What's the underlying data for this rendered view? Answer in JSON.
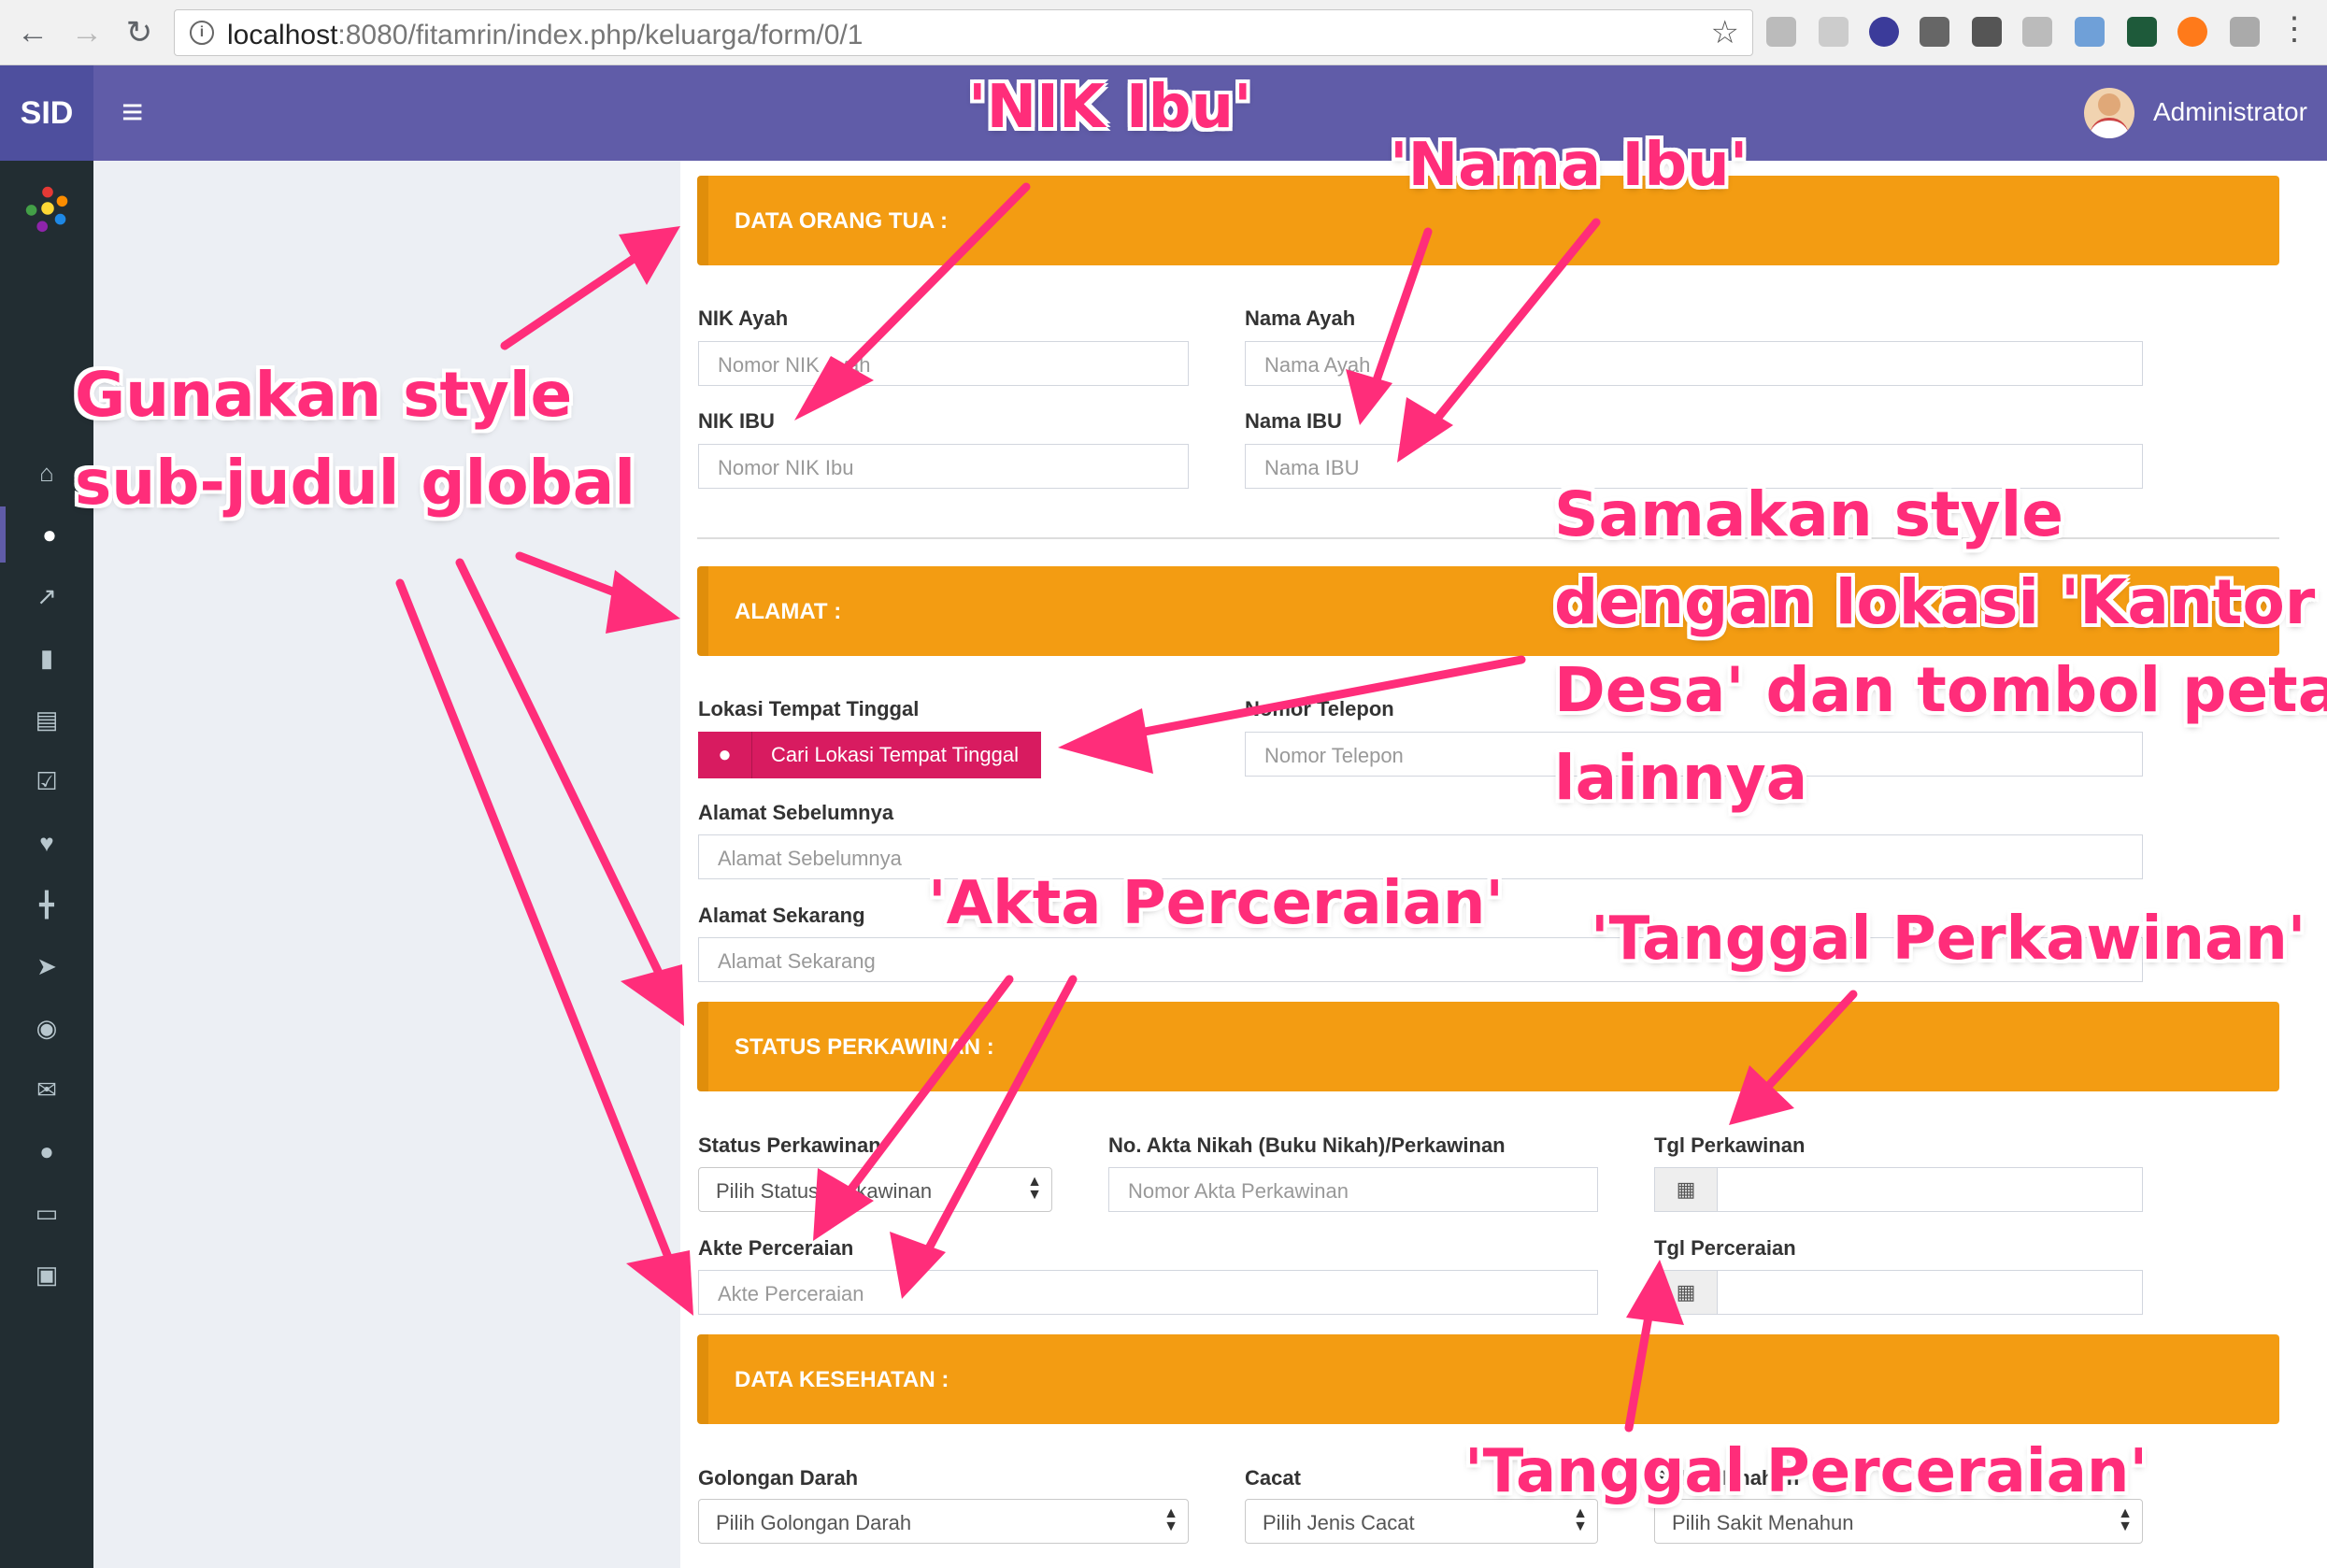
{
  "browser": {
    "url_host": "localhost",
    "url_rest": ":8080/fitamrin/index.php/keluarga/form/0/1",
    "info_icon": "i"
  },
  "header": {
    "brand": "SID",
    "user_name": "Administrator"
  },
  "sections": {
    "orang_tua": "DATA ORANG TUA :",
    "alamat": "ALAMAT :",
    "perkawinan": "STATUS PERKAWINAN :",
    "kesehatan": "DATA KESEHATAN :"
  },
  "orang_tua": {
    "nik_ayah_label": "NIK Ayah",
    "nik_ayah_placeholder": "Nomor NIK Ayah",
    "nama_ayah_label": "Nama Ayah",
    "nama_ayah_placeholder": "Nama Ayah",
    "nik_ibu_label": "NIK IBU",
    "nik_ibu_placeholder": "Nomor NIK Ibu",
    "nama_ibu_label": "Nama IBU",
    "nama_ibu_placeholder": "Nama IBU"
  },
  "alamat": {
    "lokasi_label": "Lokasi Tempat Tinggal",
    "lokasi_button": "Cari Lokasi Tempat Tinggal",
    "telepon_label": "Nomor Telepon",
    "telepon_placeholder": "Nomor Telepon",
    "sebelumnya_label": "Alamat Sebelumnya",
    "sebelumnya_placeholder": "Alamat Sebelumnya",
    "sekarang_label": "Alamat Sekarang",
    "sekarang_placeholder": "Alamat Sekarang"
  },
  "perkawinan": {
    "status_label": "Status Perkawinan",
    "status_select": "Pilih Status Perkawinan",
    "akta_nikah_label": "No. Akta Nikah (Buku Nikah)/Perkawinan",
    "akta_nikah_placeholder": "Nomor Akta Perkawinan",
    "tgl_perkawinan_label": "Tgl Perkawinan",
    "akte_cerai_label": "Akte Perceraian",
    "akte_cerai_placeholder": "Akte Perceraian",
    "tgl_perceraian_label": "Tgl Perceraian"
  },
  "kesehatan": {
    "darah_label": "Golongan Darah",
    "darah_select": "Pilih Golongan Darah",
    "cacat_label": "Cacat",
    "cacat_select": "Pilih Jenis Cacat",
    "sakit_label": "Sakit Menahun",
    "sakit_select": "Pilih Sakit Menahun"
  },
  "annotations": {
    "nik_ibu": "'NIK Ibu'",
    "nama_ibu": "'Nama Ibu'",
    "subjudul_1": "Gunakan style",
    "subjudul_2": "sub-judul global",
    "samakan_1": "Samakan style",
    "samakan_2": "dengan lokasi 'Kantor",
    "samakan_3": "Desa' dan tombol peta",
    "samakan_4": "lainnya",
    "akta": "'Akta Perceraian'",
    "tgl_kawin": "'Tanggal Perkawinan'",
    "tgl_cerai": "'Tanggal Perceraian'"
  },
  "colors": {
    "header": "#605ca8",
    "section": "#f39c12",
    "map_button": "#d81b60",
    "annotation": "#ff2d7a"
  }
}
